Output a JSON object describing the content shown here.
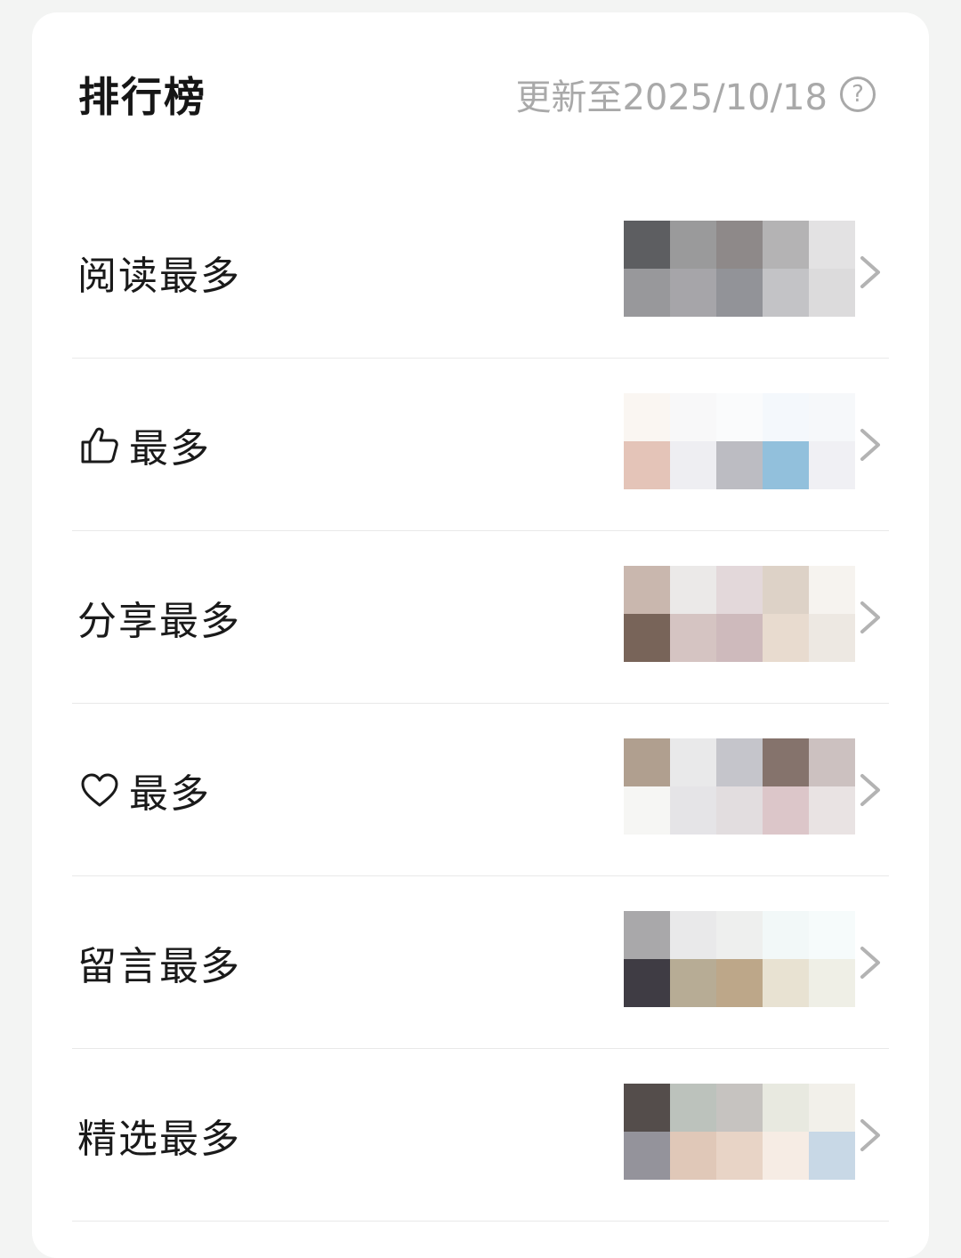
{
  "header": {
    "title": "排行榜",
    "update_text": "更新至2025/10/18",
    "help_icon": "help-icon",
    "help_glyph": "?"
  },
  "rows": [
    {
      "label": "阅读最多",
      "icon": null,
      "thumbs": [
        "#5d5e61",
        "#9a9a9b",
        "#8e8989",
        "#b4b3b4",
        "#e3e2e3",
        "#98989b",
        "#a6a5a9",
        "#929398",
        "#c3c3c6",
        "#dcdbdc"
      ]
    },
    {
      "label": "最多",
      "icon": "thumbs-up-icon",
      "thumbs": [
        "#faf6f2",
        "#f8f8f9",
        "#fafbfc",
        "#f4f8fc",
        "#f6f8fa",
        "#e4c4b8",
        "#eeeef2",
        "#bcbcc2",
        "#92c0dc",
        "#f0f0f4"
      ]
    },
    {
      "label": "分享最多",
      "icon": null,
      "thumbs": [
        "#c9b7ae",
        "#ebe9e8",
        "#e3d8da",
        "#ddd2c7",
        "#f6f3ef",
        "#786459",
        "#d5c4c2",
        "#cebabc",
        "#e8dbcf",
        "#ede8e2"
      ]
    },
    {
      "label": "最多",
      "icon": "heart-icon",
      "thumbs": [
        "#b09f8f",
        "#e9e9ea",
        "#c5c5cb",
        "#85736c",
        "#ccc1c0",
        "#f6f6f4",
        "#e5e4e7",
        "#e2dddf",
        "#dcc6c9",
        "#e9e3e3"
      ]
    },
    {
      "label": "留言最多",
      "icon": null,
      "thumbs": [
        "#a9a8aa",
        "#e9e9ea",
        "#eeefee",
        "#f2f8f8",
        "#f6fbfb",
        "#3f3c44",
        "#b7ac95",
        "#bda789",
        "#e8e2d2",
        "#efefe6"
      ]
    },
    {
      "label": "精选最多",
      "icon": null,
      "thumbs": [
        "#544d4b",
        "#bcc2bc",
        "#c6c3c0",
        "#e8e9e0",
        "#f2f0ea",
        "#94939b",
        "#e0c8b8",
        "#e8d4c6",
        "#f6ece4",
        "#c8d8e6"
      ]
    }
  ],
  "colors": {
    "background": "#f3f4f3",
    "card": "#ffffff",
    "chevron": "#b3b3b3",
    "muted_text": "#a9a9a9"
  }
}
